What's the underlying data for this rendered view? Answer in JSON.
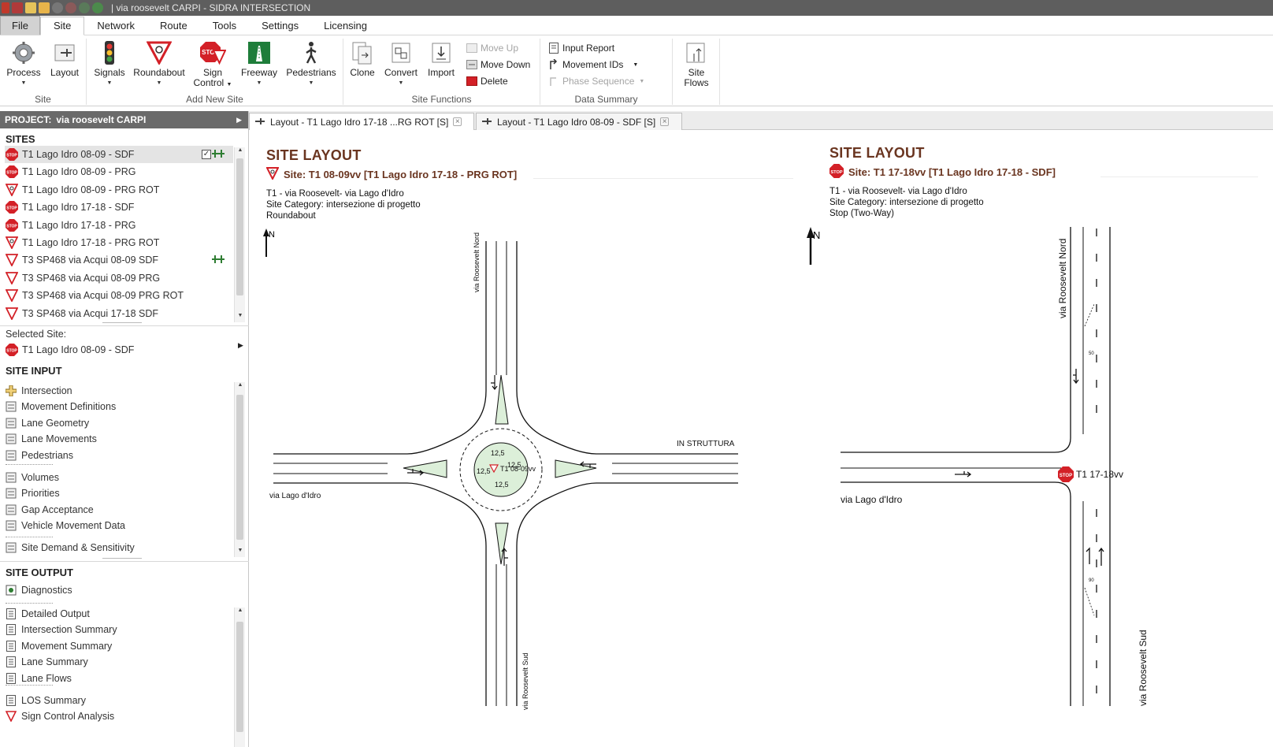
{
  "window": {
    "title": "| via roosevelt CARPI - SIDRA INTERSECTION"
  },
  "menu": {
    "file": "File",
    "tabs": [
      "Site",
      "Network",
      "Route",
      "Tools",
      "Settings",
      "Licensing"
    ]
  },
  "ribbon": {
    "site_group": {
      "label": "Site",
      "process": "Process",
      "layout": "Layout"
    },
    "add_site_group": {
      "label": "Add New Site",
      "signals": "Signals",
      "roundabout": "Roundabout",
      "sign_control_1": "Sign",
      "sign_control_2": "Control",
      "freeway": "Freeway",
      "pedestrians": "Pedestrians"
    },
    "site_functions": {
      "label": "Site Functions",
      "clone": "Clone",
      "convert": "Convert",
      "import": "Import",
      "move_up": "Move Up",
      "move_down": "Move Down",
      "delete": "Delete"
    },
    "data_summary": {
      "label": "Data Summary",
      "input_report": "Input Report",
      "movement_ids": "Movement IDs",
      "phase_sequence": "Phase Sequence"
    },
    "site_flows_1": "Site",
    "site_flows_2": "Flows"
  },
  "project": {
    "label": "PROJECT:",
    "name": "via roosevelt CARPI"
  },
  "sites": {
    "header": "SITES",
    "items": [
      {
        "icon": "stop-sign-icon",
        "label": "T1 Lago Idro 08-09 - SDF"
      },
      {
        "icon": "stop-sign-icon",
        "label": "T1 Lago Idro 08-09 - PRG"
      },
      {
        "icon": "roundabout-yield-icon",
        "label": "T1 Lago Idro 08-09 - PRG ROT"
      },
      {
        "icon": "stop-sign-icon",
        "label": "T1 Lago Idro 17-18  - SDF"
      },
      {
        "icon": "stop-sign-icon",
        "label": "T1 Lago Idro 17-18  - PRG"
      },
      {
        "icon": "roundabout-yield-icon",
        "label": "T1 Lago Idro 17-18 - PRG ROT"
      },
      {
        "icon": "yield-sign-icon",
        "label": "T3 SP468 via Acqui 08-09 SDF"
      },
      {
        "icon": "yield-sign-icon",
        "label": "T3 SP468 via Acqui 08-09 PRG"
      },
      {
        "icon": "yield-sign-icon",
        "label": "T3 SP468 via Acqui 08-09 PRG ROT"
      },
      {
        "icon": "yield-sign-icon",
        "label": "T3 SP468 via Acqui 17-18 SDF"
      }
    ]
  },
  "selected_site": {
    "label": "Selected Site:",
    "name": "T1 Lago Idro 08-09 - SDF"
  },
  "site_input": {
    "header": "SITE INPUT",
    "items": [
      "Intersection",
      "Movement Definitions",
      "Lane Geometry",
      "Lane Movements",
      "Pedestrians",
      "Volumes",
      "Priorities",
      "Gap Acceptance",
      "Vehicle Movement Data",
      "Site Demand & Sensitivity"
    ]
  },
  "site_output": {
    "header": "SITE OUTPUT",
    "items": [
      "Diagnostics",
      "Detailed Output",
      "Intersection Summary",
      "Movement Summary",
      "Lane Summary",
      "Lane Flows",
      "LOS Summary",
      "Sign Control Analysis"
    ]
  },
  "doc_tabs": [
    {
      "label": "Layout - T1 Lago Idro 17-18 ...RG ROT [S]"
    },
    {
      "label": "Layout - T1 Lago Idro 08-09 - SDF [S]"
    }
  ],
  "layout_left": {
    "title": "SITE LAYOUT",
    "site": "Site: T1 08-09vv  [T1 Lago Idro 17-18 - PRG ROT]",
    "info": [
      "T1 - via Roosevelt- via Lago d'Idro",
      "Site Category: intersezione di progetto",
      "Roundabout"
    ],
    "north": "N",
    "road_north": "via Roosevelt Nord",
    "road_south": "via Roosevelt Sud",
    "road_west": "via Lago d'Idro",
    "road_east": "IN STRUTTURA",
    "island_labels": [
      "12,5",
      "12,5",
      "12,5",
      "12,5"
    ],
    "site_id": "T1 08-09vv"
  },
  "layout_right": {
    "title": "SITE LAYOUT",
    "site": "Site: T1 17-18vv  [T1 Lago Idro 17-18  - SDF]",
    "info": [
      "T1 - via Roosevelt- via Lago d'Idro",
      "Site Category: intersezione di progetto",
      "Stop (Two-Way)"
    ],
    "north": "N",
    "road_north": "via Roosevelt Nord",
    "road_south": "via Roosevelt Sud",
    "road_west": "via Lago d'Idro",
    "site_id": "T1 17-18vv",
    "lane_len_n": "50",
    "lane_len_s": "90"
  },
  "colors": {
    "accent_brown": "#6a3520",
    "stop_red": "#d32027",
    "island_green": "#dcefd9"
  }
}
